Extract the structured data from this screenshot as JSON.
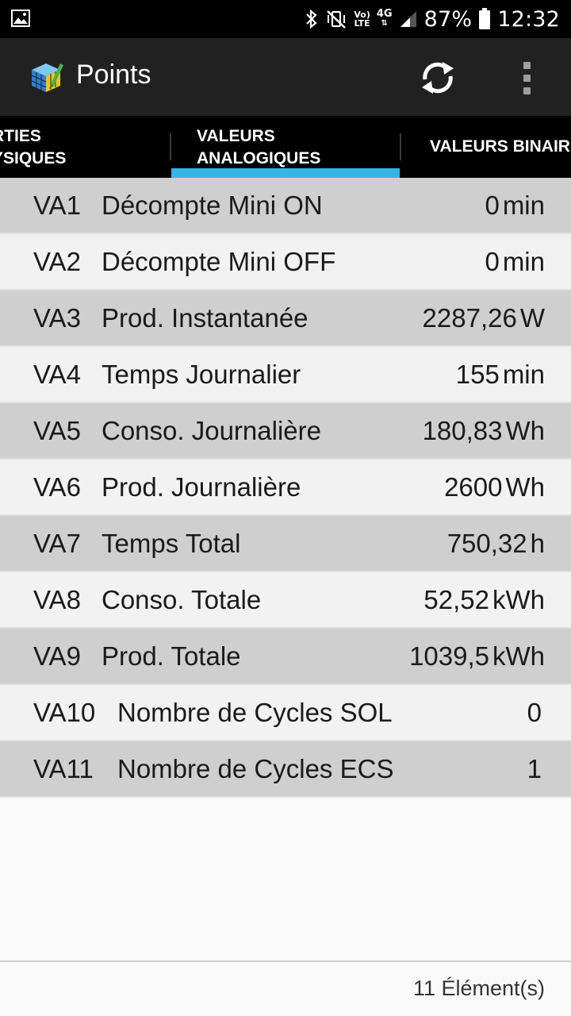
{
  "status_bar": {
    "battery": "87%",
    "time": "12:32",
    "network_type": "4G",
    "volte_top": "Vo)",
    "volte_bottom": "LTE",
    "icons": [
      "gallery-icon",
      "bluetooth-icon",
      "vibrate-mute-icon",
      "volte-icon",
      "network-4g-icon",
      "signal-icon",
      "battery-icon"
    ]
  },
  "app_bar": {
    "title": "Points",
    "icons": [
      "app-cube-icon",
      "refresh-icon",
      "overflow-menu-icon"
    ]
  },
  "tabs": [
    {
      "label": "RTIES\nYSIQUES"
    },
    {
      "label": "VALEURS\nANALOGIQUES",
      "selected": true
    },
    {
      "label": "VALEURS BINAIR"
    }
  ],
  "rows": [
    {
      "code": "VA1",
      "label": "Décompte Mini ON",
      "value": "0",
      "unit": "min"
    },
    {
      "code": "VA2",
      "label": "Décompte Mini OFF",
      "value": "0",
      "unit": "min"
    },
    {
      "code": "VA3",
      "label": "Prod. Instantanée",
      "value": "2287,26",
      "unit": "W"
    },
    {
      "code": "VA4",
      "label": "Temps Journalier",
      "value": "155",
      "unit": "min"
    },
    {
      "code": "VA5",
      "label": "Conso. Journalière",
      "value": "180,83",
      "unit": "Wh"
    },
    {
      "code": "VA6",
      "label": "Prod. Journalière",
      "value": "2600",
      "unit": "Wh"
    },
    {
      "code": "VA7",
      "label": "Temps Total",
      "value": "750,32",
      "unit": "h"
    },
    {
      "code": "VA8",
      "label": "Conso. Totale",
      "value": "52,52",
      "unit": "kWh"
    },
    {
      "code": "VA9",
      "label": "Prod. Totale",
      "value": "1039,5",
      "unit": "kWh"
    },
    {
      "code": "VA10",
      "label": "Nombre de Cycles SOL",
      "value": "0",
      "unit": ""
    },
    {
      "code": "VA11",
      "label": "Nombre de Cycles ECS",
      "value": "1",
      "unit": ""
    }
  ],
  "footer": {
    "count": "11 Élément(s)"
  },
  "colors": {
    "status_bar": "#000000",
    "app_bar": "#212121",
    "tab_bar": "#000000",
    "tab_indicator": "#33b5e5",
    "row_dark": "#cfcfcf",
    "row_light": "#f2f2f2"
  }
}
